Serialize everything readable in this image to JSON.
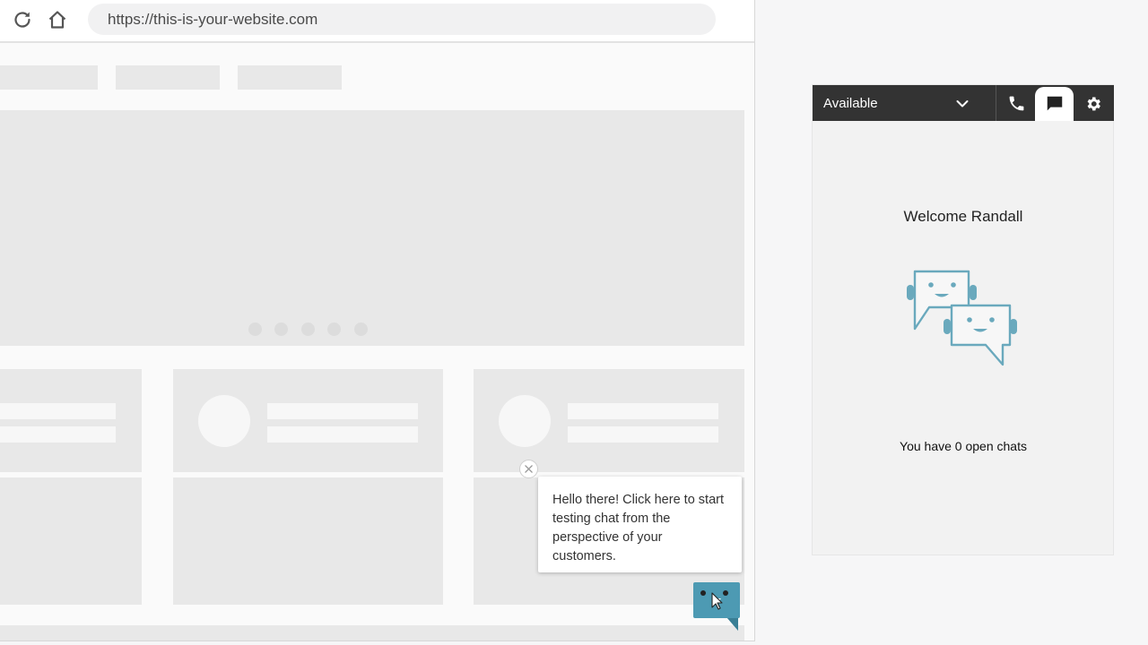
{
  "browser": {
    "url": "https://this-is-your-website.com",
    "carousel_dots": 5
  },
  "chat_widget": {
    "tooltip_text": "Hello there! Click here to start testing chat from the perspective of your customers.",
    "accent_color": "#4d9ab3"
  },
  "ccp": {
    "status": "Available",
    "tabs": [
      "phone-icon",
      "chat-icon",
      "gear-icon"
    ],
    "active_tab": "chat-icon",
    "welcome": "Welcome Randall",
    "open_chats": "You have 0 open chats",
    "header_color": "#333333"
  }
}
